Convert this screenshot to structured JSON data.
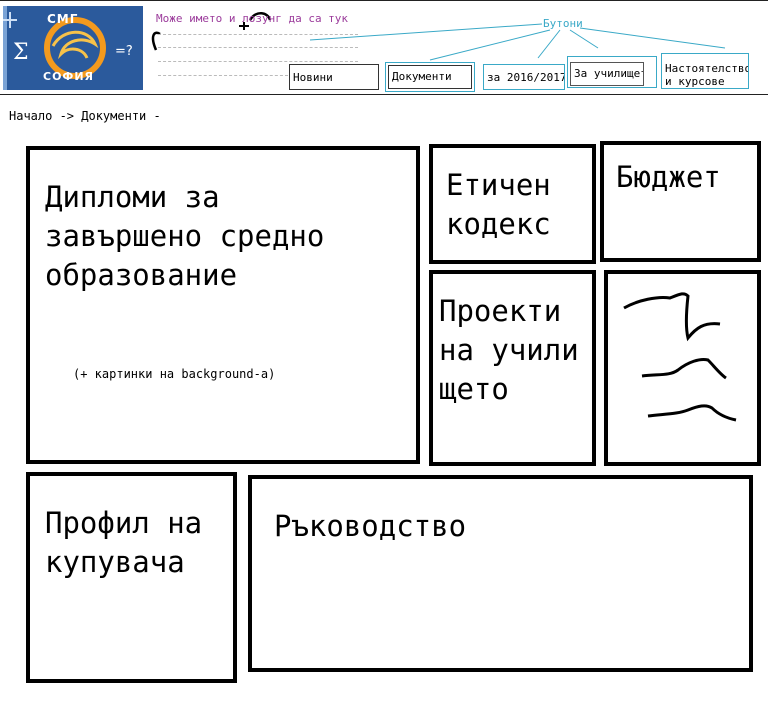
{
  "header": {
    "logo_top": "СМГ",
    "logo_bottom": "СОФИЯ",
    "logo_sigma": "Σ",
    "logo_eq": "=?",
    "slogan": "Може името и лозунг да са тук",
    "buttons_label": "Бутони",
    "nav": [
      "Новини",
      "Документи",
      "за 2016/2017",
      "За училището",
      "Настоятелство и курсове"
    ]
  },
  "breadcrumb": "Начало -> Документи -",
  "tiles": {
    "diplomas": {
      "title": "Дипломи за завършено средно образование",
      "note": "(+ картинки на background-a)"
    },
    "ethics": {
      "title": "Етичен кодекс"
    },
    "budget": {
      "title": "Бюджет"
    },
    "projects": {
      "title": "Проекти на училището"
    },
    "profile": {
      "title": "Профил на купувача"
    },
    "management": {
      "title": "Ръководство"
    }
  },
  "colors": {
    "slogan": "#9b3b9b",
    "buttons_annotation": "#3aa9c7",
    "logo_bg": "#2b5a9c"
  }
}
